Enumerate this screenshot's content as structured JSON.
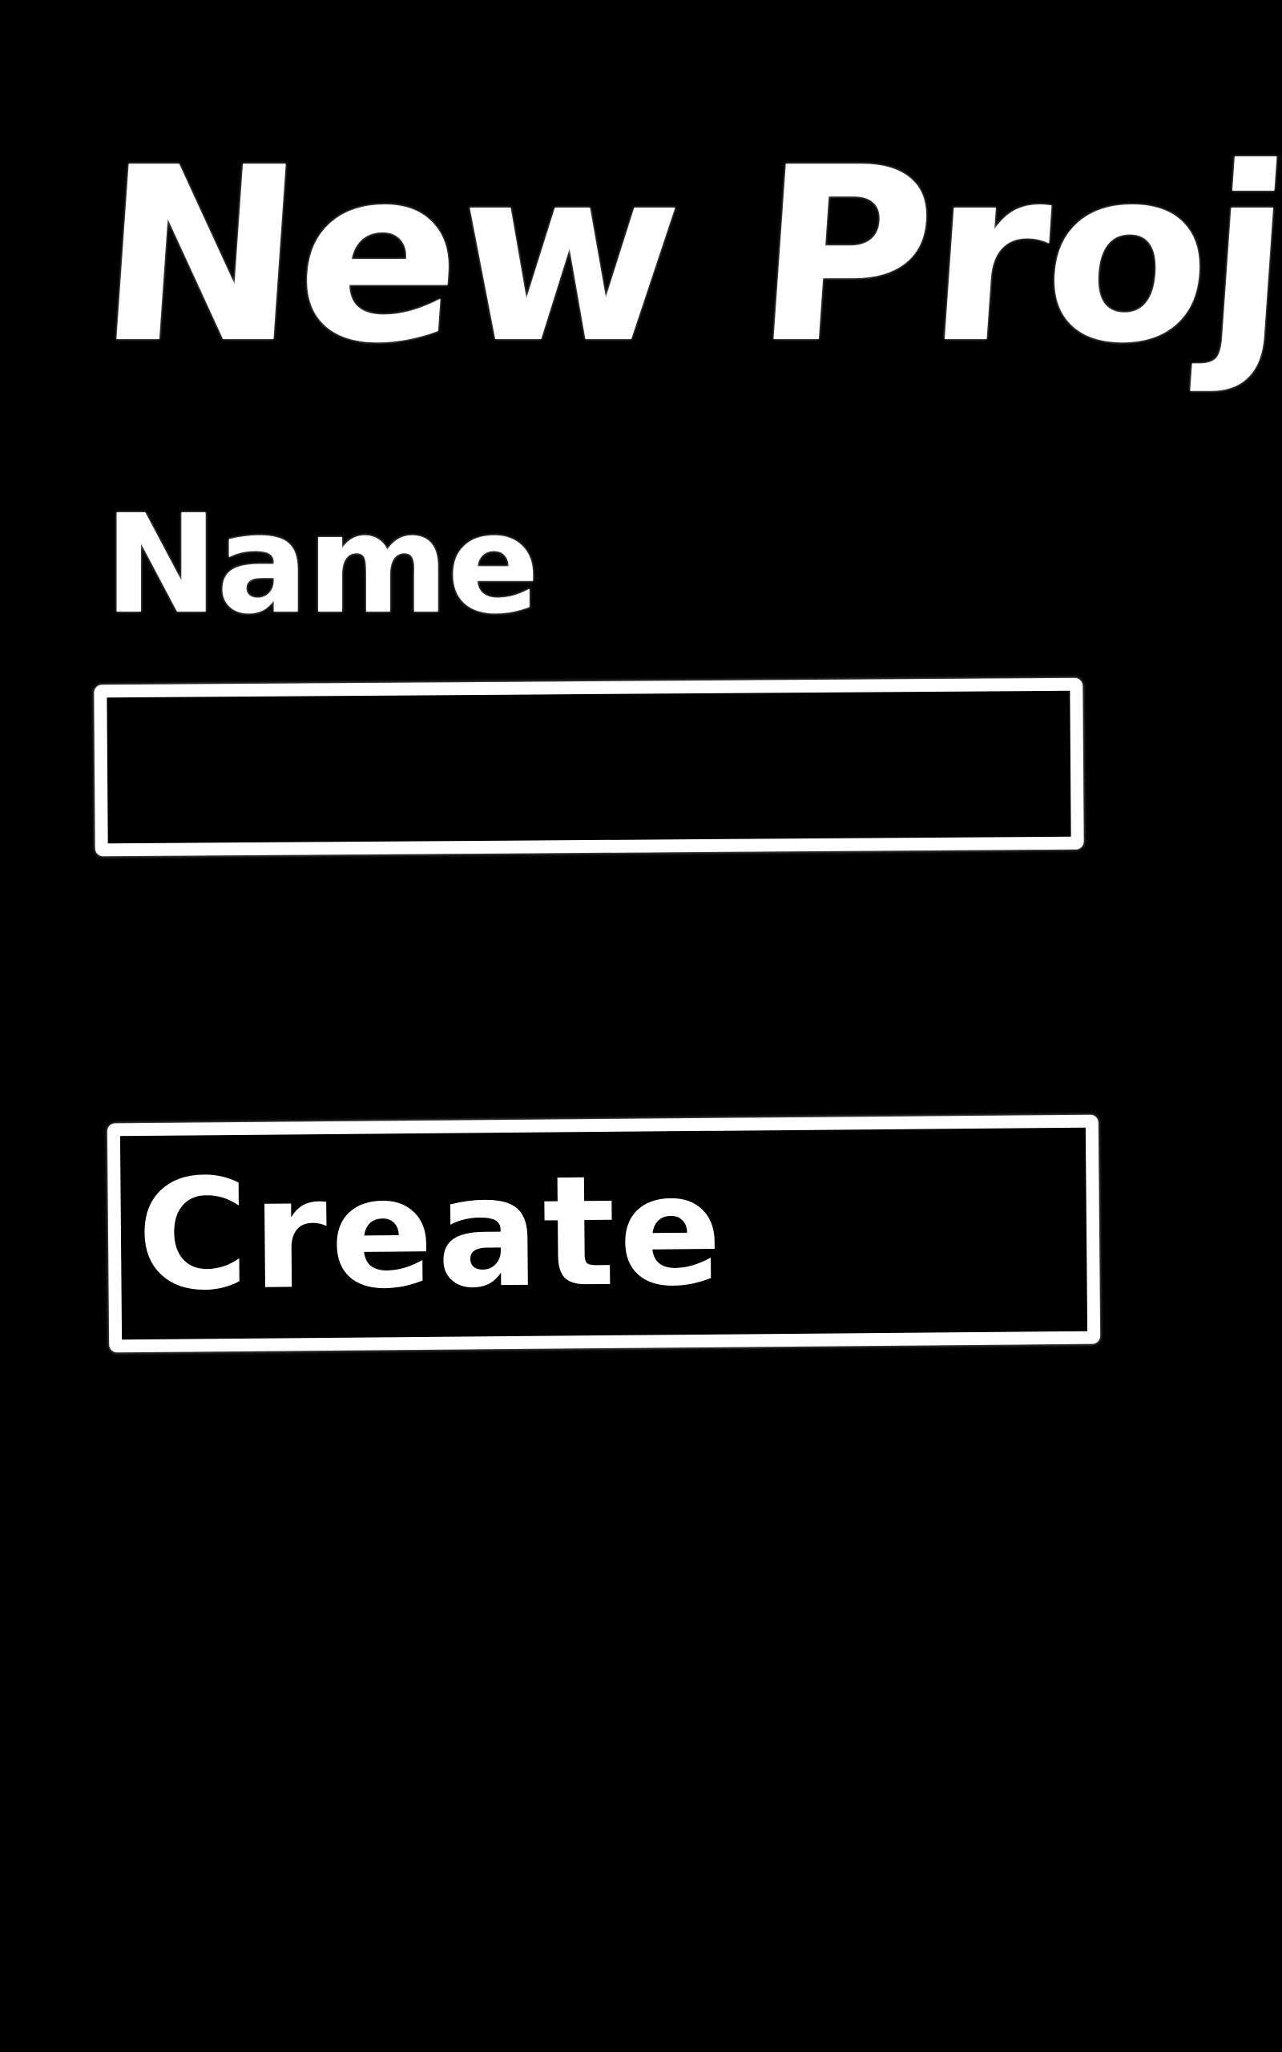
{
  "header": {
    "title": "New Proj"
  },
  "form": {
    "name_label": "Name",
    "name_value": "",
    "create_label": "Create"
  },
  "colors": {
    "background": "#000000",
    "stroke": "#ffffff"
  }
}
